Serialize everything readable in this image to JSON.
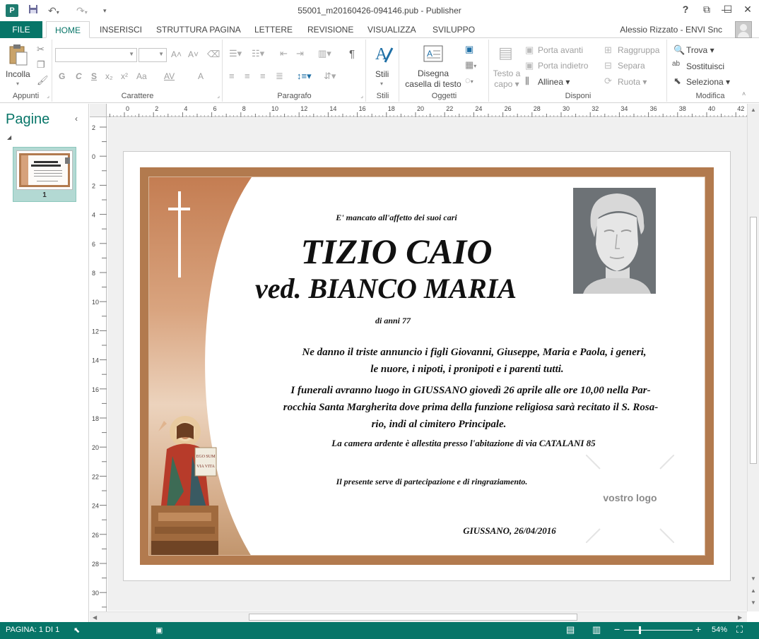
{
  "window": {
    "title": "55001_m20160426-094146.pub - Publisher",
    "app_icon": "P",
    "controls": {
      "help": "?",
      "restore_ribbon": "⧉",
      "minimize": "—",
      "maximize": "☐",
      "close": "✕"
    }
  },
  "quick_access": {
    "save_icon": "save-icon",
    "undo_icon": "undo-icon",
    "redo_icon": "redo-icon",
    "customize_icon": "customize-icon"
  },
  "tabs": {
    "file": "FILE",
    "items": [
      "HOME",
      "INSERISCI",
      "STRUTTURA PAGINA",
      "LETTERE",
      "REVISIONE",
      "VISUALIZZA",
      "SVILUPPO"
    ],
    "active": "HOME"
  },
  "user": {
    "name": "Alessio Rizzato - ENVI Snc"
  },
  "ribbon": {
    "appunti": {
      "label": "Appunti",
      "paste": "Incolla"
    },
    "carattere": {
      "label": "Carattere",
      "font_value": "",
      "size_value": "",
      "bold": "G",
      "italic": "C",
      "underline": "S",
      "subscript": "x₂",
      "superscript": "x²",
      "case": "Aa",
      "spacing": "AV",
      "color": "A",
      "grow": "A˄",
      "shrink": "A˅"
    },
    "paragrafo": {
      "label": "Paragrafo",
      "pilcrow": "¶"
    },
    "stili": {
      "label": "Stili",
      "button": "Stili"
    },
    "oggetti": {
      "label": "Oggetti",
      "draw_textbox_line1": "Disegna",
      "draw_textbox_line2": "casella di testo"
    },
    "disponi": {
      "label": "Disponi",
      "wrap_line1": "Testo a",
      "wrap_line2": "capo",
      "bring_forward": "Porta avanti",
      "send_backward": "Porta indietro",
      "align": "Allinea",
      "group": "Raggruppa",
      "ungroup": "Separa",
      "rotate": "Ruota"
    },
    "modifica": {
      "label": "Modifica",
      "find": "Trova",
      "replace": "Sostituisci",
      "select": "Seleziona"
    }
  },
  "pages_pane": {
    "title": "Pagine",
    "page_number": "1"
  },
  "ruler": {
    "horizontal": [
      "0",
      "2",
      "4",
      "6",
      "8",
      "10",
      "12",
      "14",
      "16",
      "18",
      "20",
      "22",
      "24",
      "26",
      "28",
      "30",
      "32",
      "34",
      "36",
      "38",
      "40",
      "42"
    ],
    "vertical": [
      "2",
      "0",
      "2",
      "4",
      "6",
      "8",
      "10",
      "12",
      "14",
      "16",
      "18",
      "20",
      "22",
      "24",
      "26",
      "28",
      "30"
    ]
  },
  "document": {
    "intro": "E' mancato all'affetto dei suoi cari",
    "name": "TIZIO CAIO",
    "widow": "ved. BIANCO MARIA",
    "age": "di anni 77",
    "announce_line1": "Ne danno il triste annuncio i figli Giovanni, Giuseppe, Maria e Paola, i generi,",
    "announce_line2": "le nuore, i nipoti, i pronipoti e i parenti tutti.",
    "funeral_line1": "I funerali avranno luogo in GIUSSANO giovedì 26 aprile alle ore 10,00 nella Par-",
    "funeral_line2": "rocchia Santa Margherita dove prima della funzione religiosa sarà recitato il S. Rosa-",
    "funeral_line3": "rio, indi al cimitero Principale.",
    "chapel": "La camera ardente è allestita presso l'abitazione di via CATALANI 85",
    "thanks": "Il presente serve di partecipazione e di ringraziamento.",
    "place_date": "GIUSSANO, 26/04/2016",
    "logo": "vostro logo",
    "book_text": "EGO SUM VIA VITA"
  },
  "status": {
    "page": "PAGINA: 1 DI 1",
    "zoom": "54%",
    "zoom_level": 0.54
  }
}
